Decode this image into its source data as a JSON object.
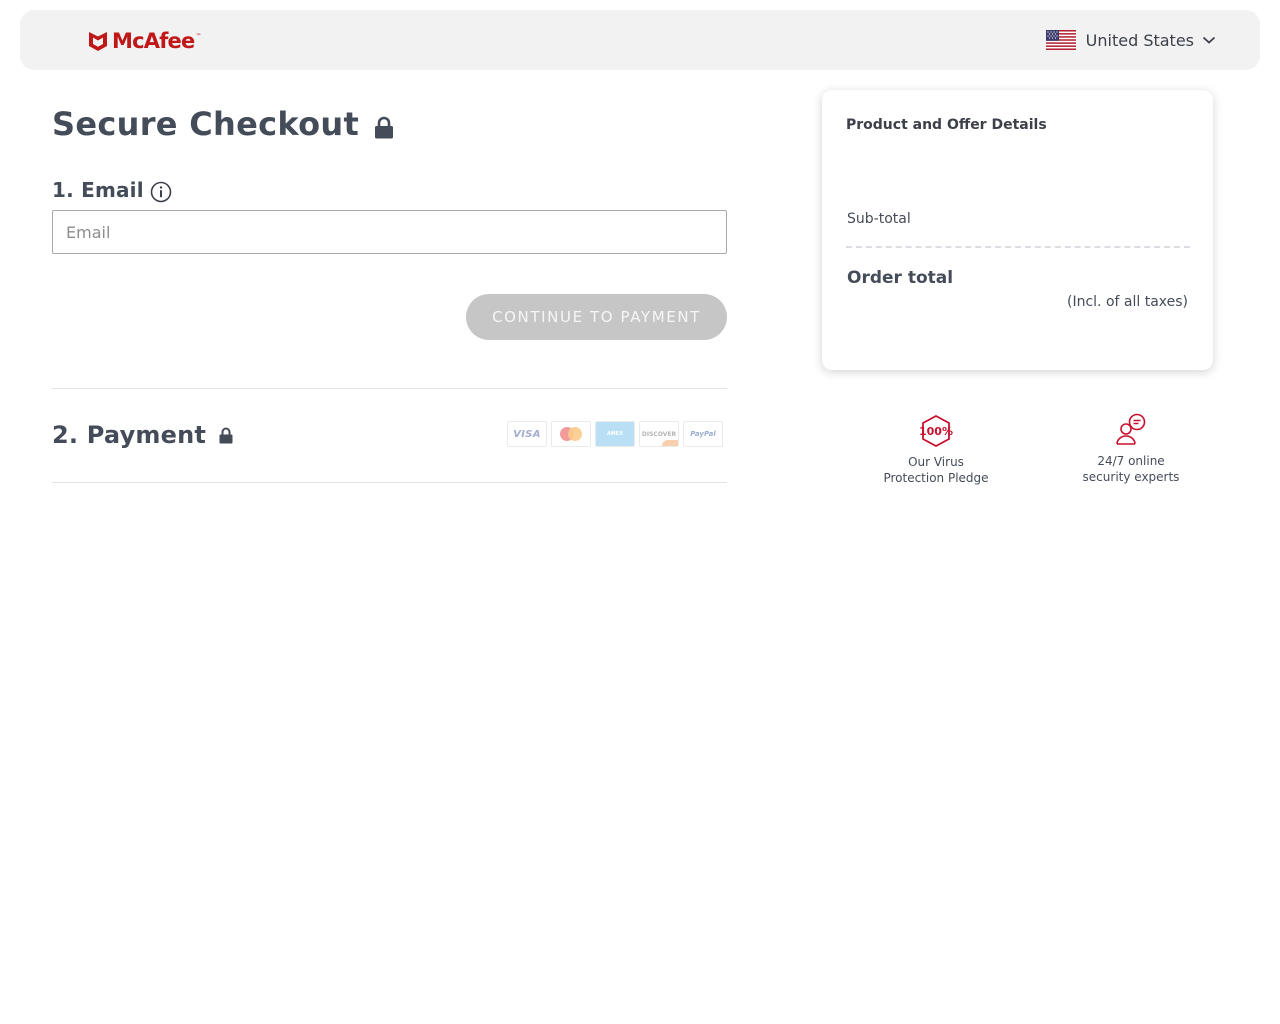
{
  "header": {
    "brand": "McAfee",
    "trademark": "™",
    "country": "United States",
    "flag": "us-flag-icon"
  },
  "checkout": {
    "title": "Secure Checkout",
    "email_section": {
      "heading": "1. Email",
      "placeholder": "Email",
      "value": ""
    },
    "continue_button": "CONTINUE TO PAYMENT",
    "payment_section": {
      "heading": "2. Payment",
      "card_labels": {
        "visa": "VISA",
        "amex": "AMEX",
        "discover": "DISCOVER",
        "paypal": "PayPal"
      }
    }
  },
  "summary": {
    "title": "Product and Offer Details",
    "subtotal_label": "Sub-total",
    "order_total_label": "Order total",
    "taxes_note": "(Incl. of all taxes)"
  },
  "badges": {
    "pledge_icon": "100%",
    "pledge_line1": "Our Virus",
    "pledge_line2": "Protection Pledge",
    "experts_line1": "24/7 online",
    "experts_line2": "security experts"
  },
  "colors": {
    "brand_red": "#c01818",
    "accent_crimson": "#c8102e",
    "text_dark": "#454c59",
    "button_disabled": "#c6c6c6"
  }
}
